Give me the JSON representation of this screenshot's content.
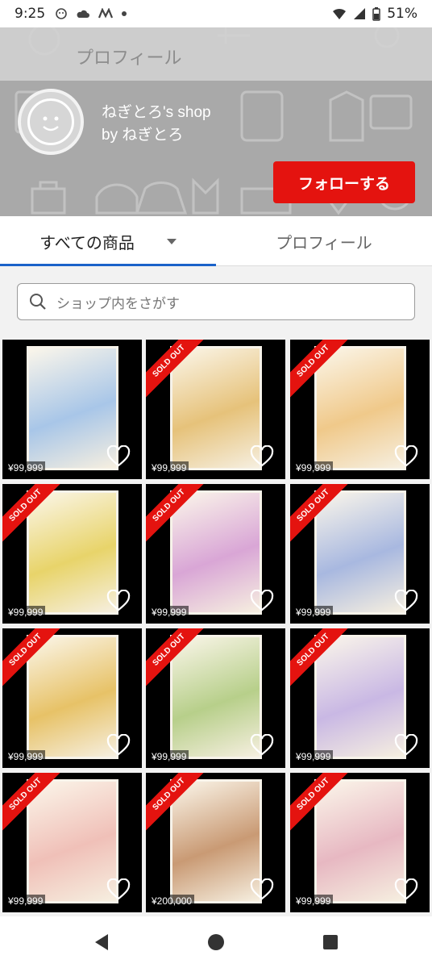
{
  "status_bar": {
    "time": "9:25",
    "battery": "51%"
  },
  "header": {
    "title": "プロフィール",
    "shop_name_line1": "ねぎとろ's shop",
    "shop_name_line2": "by ねぎとろ",
    "follow_label": "フォローする"
  },
  "tabs": [
    {
      "label": "すべての商品",
      "active": true
    },
    {
      "label": "プロフィール",
      "active": false
    }
  ],
  "search": {
    "placeholder": "ショップ内をさがす"
  },
  "sold_label": "SOLD OUT",
  "items": [
    {
      "price": "¥99,999",
      "sold_out": false,
      "tone": "#a8c6e8"
    },
    {
      "price": "¥99,999",
      "sold_out": true,
      "tone": "#e6c27a"
    },
    {
      "price": "¥99,999",
      "sold_out": true,
      "tone": "#f0c98a"
    },
    {
      "price": "¥99,999",
      "sold_out": true,
      "tone": "#e8d46a"
    },
    {
      "price": "¥99,999",
      "sold_out": true,
      "tone": "#d9a6d6"
    },
    {
      "price": "¥99,999",
      "sold_out": true,
      "tone": "#a8b8e0"
    },
    {
      "price": "¥99,999",
      "sold_out": true,
      "tone": "#e7c267"
    },
    {
      "price": "¥99,999",
      "sold_out": true,
      "tone": "#b7cf8a"
    },
    {
      "price": "¥99,999",
      "sold_out": true,
      "tone": "#c9b8e4"
    },
    {
      "price": "¥99,999",
      "sold_out": true,
      "tone": "#f0c0b8"
    },
    {
      "price": "¥200,000",
      "sold_out": true,
      "tone": "#c99a74"
    },
    {
      "price": "¥99,999",
      "sold_out": true,
      "tone": "#e7b8c2"
    }
  ],
  "colors": {
    "accent": "#e4130f",
    "tab_indicator": "#1a62c9"
  }
}
